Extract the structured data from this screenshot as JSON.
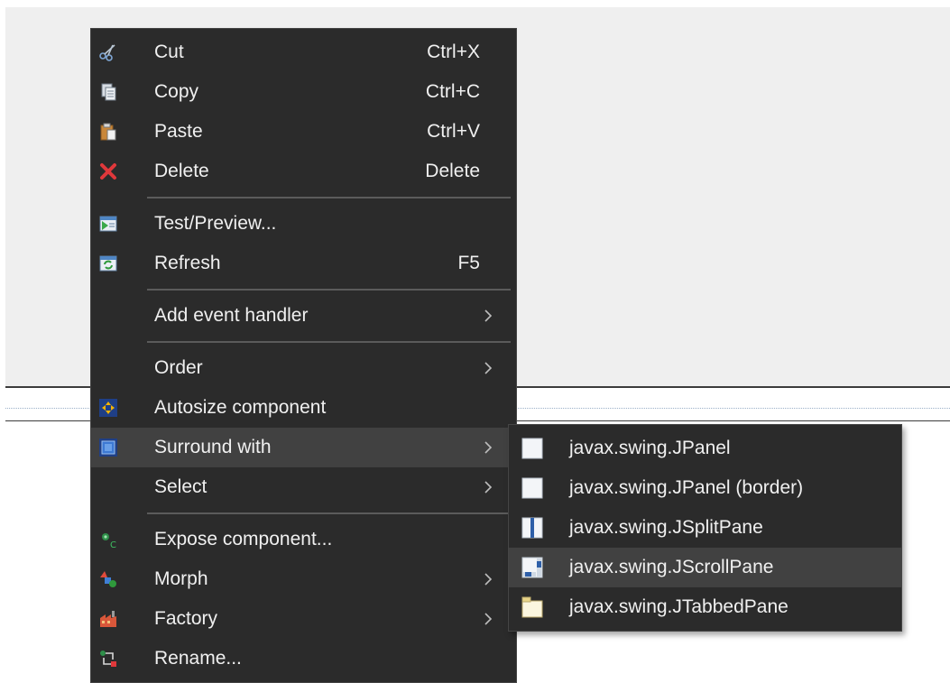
{
  "main_menu": {
    "items": [
      {
        "label": "Cut",
        "shortcut": "Ctrl+X",
        "icon": "scissors-icon"
      },
      {
        "label": "Copy",
        "shortcut": "Ctrl+C",
        "icon": "copy-icon"
      },
      {
        "label": "Paste",
        "shortcut": "Ctrl+V",
        "icon": "paste-icon"
      },
      {
        "label": "Delete",
        "shortcut": "Delete",
        "icon": "delete-icon"
      },
      {
        "label": "Test/Preview...",
        "shortcut": "",
        "icon": "preview-icon"
      },
      {
        "label": "Refresh",
        "shortcut": "F5",
        "icon": "refresh-icon"
      },
      {
        "label": "Add event handler",
        "submenu": true
      },
      {
        "label": "Order",
        "submenu": true
      },
      {
        "label": "Autosize component",
        "icon": "autosize-icon"
      },
      {
        "label": "Surround with",
        "submenu": true,
        "icon": "surround-icon",
        "highlighted": true
      },
      {
        "label": "Select",
        "submenu": true
      },
      {
        "label": "Expose component...",
        "icon": "expose-icon"
      },
      {
        "label": "Morph",
        "submenu": true,
        "icon": "morph-icon"
      },
      {
        "label": "Factory",
        "submenu": true,
        "icon": "factory-icon"
      },
      {
        "label": "Rename...",
        "icon": "rename-icon"
      }
    ]
  },
  "sub_menu": {
    "items": [
      {
        "label": "javax.swing.JPanel",
        "icon": "jpanel-icon"
      },
      {
        "label": "javax.swing.JPanel (border)",
        "icon": "jpanel-border-icon"
      },
      {
        "label": "javax.swing.JSplitPane",
        "icon": "jsplitpane-icon"
      },
      {
        "label": "javax.swing.JScrollPane",
        "icon": "jscrollpane-icon",
        "highlighted": true
      },
      {
        "label": "javax.swing.JTabbedPane",
        "icon": "jtabbedpane-icon"
      }
    ]
  },
  "colors": {
    "menu_bg": "#2b2b2b",
    "menu_highlight": "#414141",
    "menu_text": "#f0f0f0",
    "design_area_bg": "#efefef"
  }
}
